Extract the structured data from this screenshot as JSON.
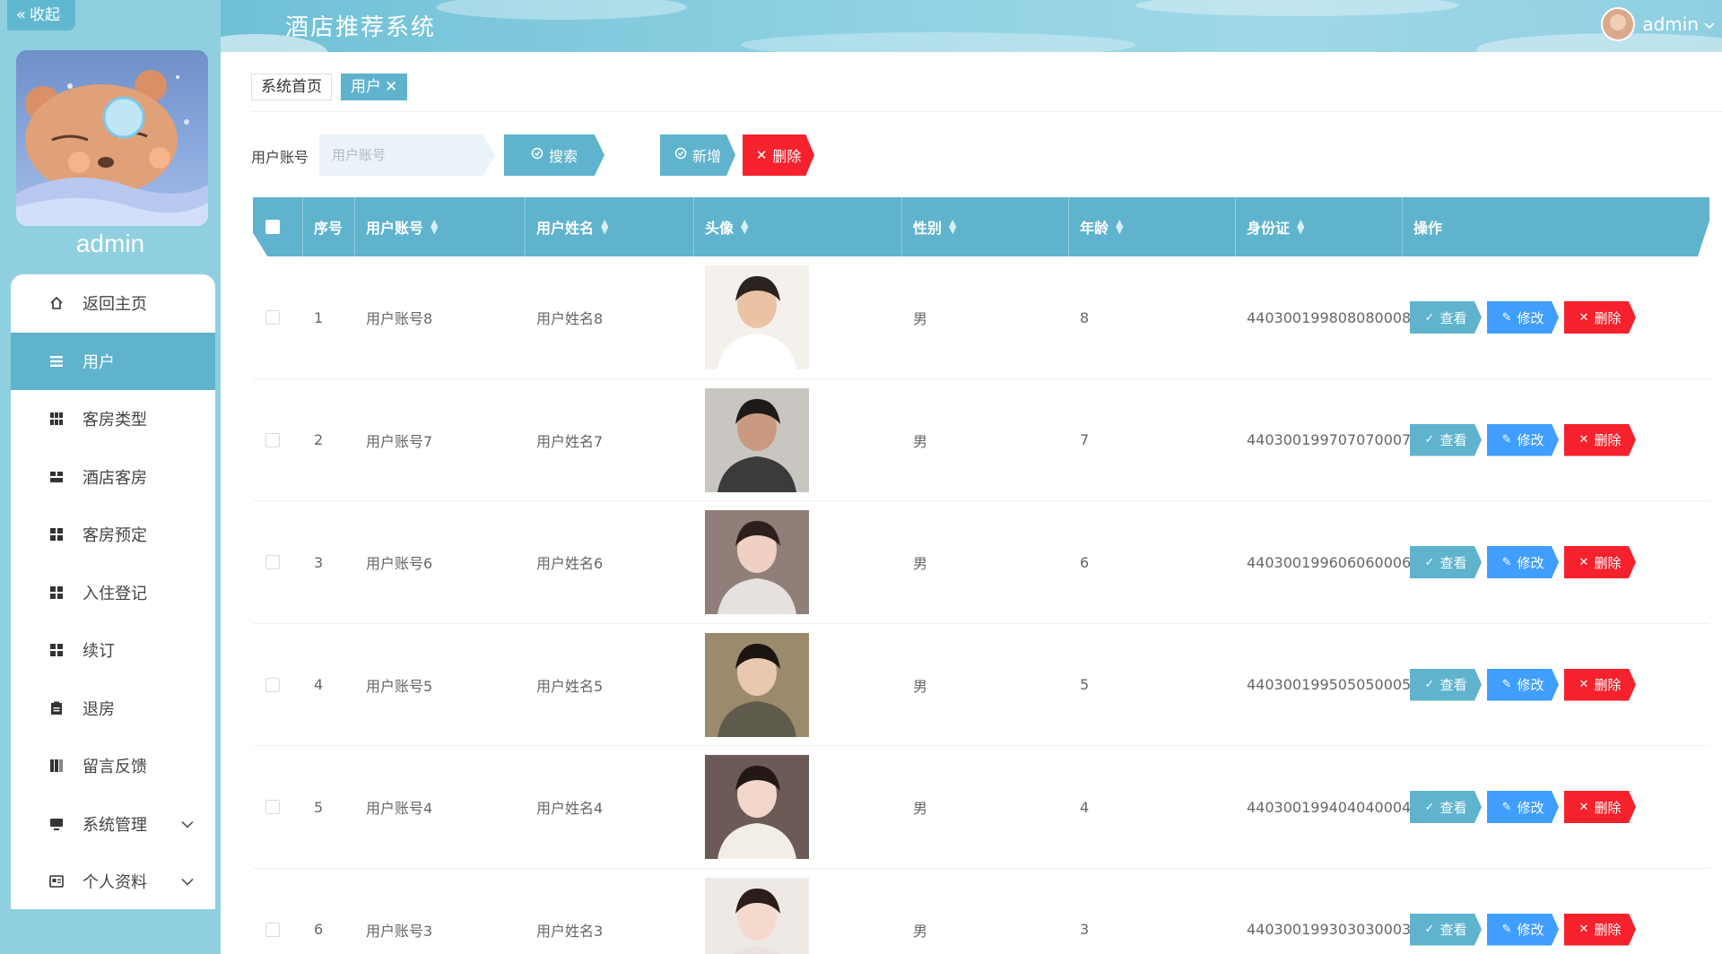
{
  "sidebar": {
    "collapse_label": "收起",
    "username": "admin",
    "menu": [
      {
        "label": "返回主页",
        "icon": "home-icon"
      },
      {
        "label": "用户",
        "icon": "list-icon",
        "active": true
      },
      {
        "label": "客房类型",
        "icon": "grid-icon"
      },
      {
        "label": "酒店客房",
        "icon": "room-icon"
      },
      {
        "label": "客房预定",
        "icon": "apps-icon"
      },
      {
        "label": "入住登记",
        "icon": "apps-icon"
      },
      {
        "label": "续订",
        "icon": "apps-icon"
      },
      {
        "label": "退房",
        "icon": "clipboard-icon"
      },
      {
        "label": "留言反馈",
        "icon": "book-icon"
      },
      {
        "label": "系统管理",
        "icon": "monitor-icon",
        "expandable": true
      },
      {
        "label": "个人资料",
        "icon": "id-card-icon",
        "expandable": true
      }
    ]
  },
  "header": {
    "title": "酒店推荐系统",
    "user": "admin"
  },
  "tabs": [
    {
      "label": "系统首页"
    },
    {
      "label": "用户",
      "active": true
    }
  ],
  "search": {
    "label": "用户账号",
    "placeholder": "用户账号",
    "search_btn": "搜索",
    "add_btn": "新增",
    "delete_btn": "删除"
  },
  "table": {
    "columns": [
      "序号",
      "用户账号",
      "用户姓名",
      "头像",
      "性别",
      "年龄",
      "身份证",
      "操作"
    ],
    "actions": {
      "view": "查看",
      "edit": "修改",
      "delete": "删除"
    },
    "rows": [
      {
        "no": "1",
        "account": "用户账号8",
        "name": "用户姓名8",
        "gender": "男",
        "age": "8",
        "id_card": "440300199808080008"
      },
      {
        "no": "2",
        "account": "用户账号7",
        "name": "用户姓名7",
        "gender": "男",
        "age": "7",
        "id_card": "440300199707070007"
      },
      {
        "no": "3",
        "account": "用户账号6",
        "name": "用户姓名6",
        "gender": "男",
        "age": "6",
        "id_card": "440300199606060006"
      },
      {
        "no": "4",
        "account": "用户账号5",
        "name": "用户姓名5",
        "gender": "男",
        "age": "5",
        "id_card": "440300199505050005"
      },
      {
        "no": "5",
        "account": "用户账号4",
        "name": "用户姓名4",
        "gender": "男",
        "age": "4",
        "id_card": "440300199404040004"
      },
      {
        "no": "6",
        "account": "用户账号3",
        "name": "用户姓名3",
        "gender": "男",
        "age": "3",
        "id_card": "440300199303030003"
      }
    ]
  },
  "colors": {
    "primary": "#5fb3cd",
    "edit": "#409eff",
    "danger": "#f5222d",
    "sidebar": "#8fcfe0"
  }
}
